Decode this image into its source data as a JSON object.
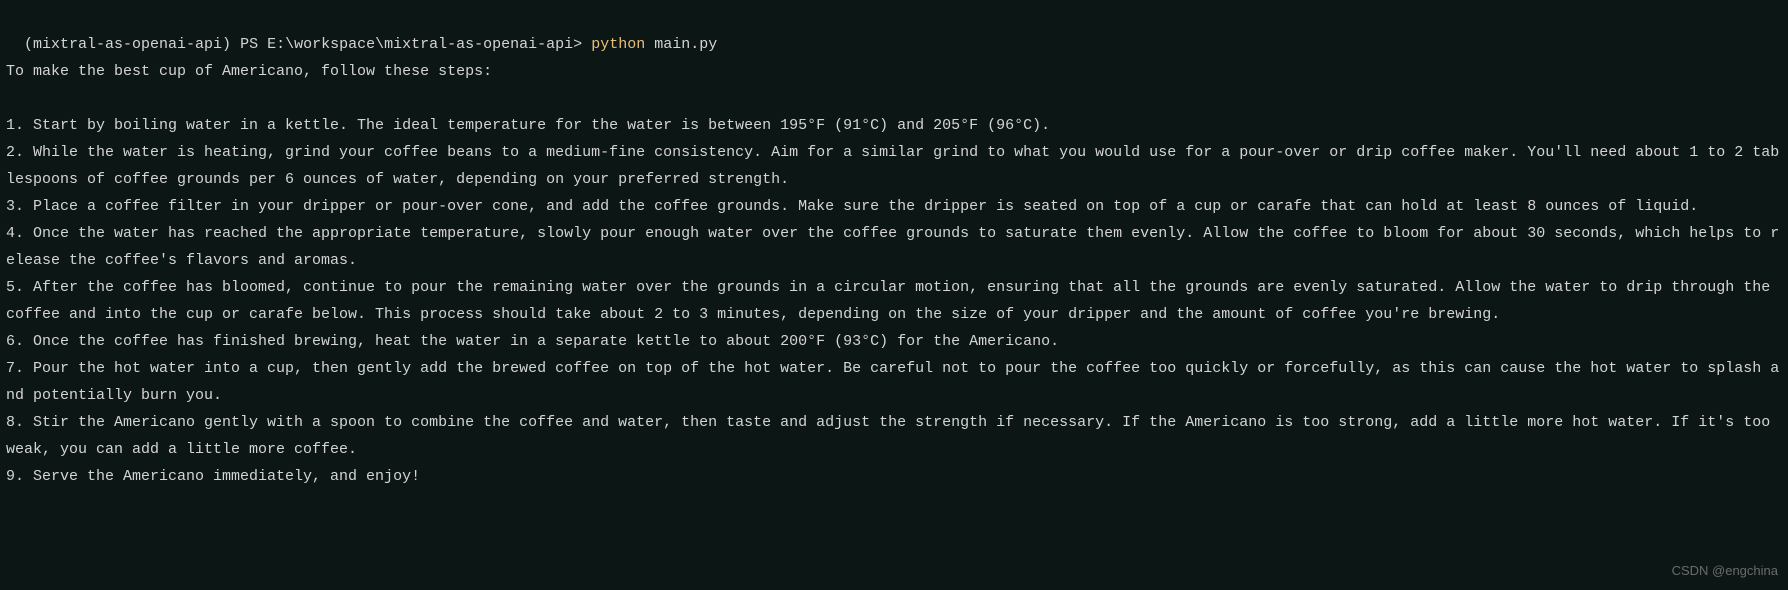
{
  "prompt": {
    "env": "(mixtral-as-openai-api)",
    "shell": "PS",
    "path": "E:\\workspace\\mixtral-as-openai-api>",
    "command": "python",
    "arg": "main.py"
  },
  "output": {
    "intro": "To make the best cup of Americano, follow these steps:",
    "steps": [
      "1. Start by boiling water in a kettle. The ideal temperature for the water is between 195°F (91°C) and 205°F (96°C).",
      "2. While the water is heating, grind your coffee beans to a medium-fine consistency. Aim for a similar grind to what you would use for a pour-over or drip coffee maker. You'll need about 1 to 2 tablespoons of coffee grounds per 6 ounces of water, depending on your preferred strength.",
      "3. Place a coffee filter in your dripper or pour-over cone, and add the coffee grounds. Make sure the dripper is seated on top of a cup or carafe that can hold at least 8 ounces of liquid.",
      "4. Once the water has reached the appropriate temperature, slowly pour enough water over the coffee grounds to saturate them evenly. Allow the coffee to bloom for about 30 seconds, which helps to release the coffee's flavors and aromas.",
      "5. After the coffee has bloomed, continue to pour the remaining water over the grounds in a circular motion, ensuring that all the grounds are evenly saturated. Allow the water to drip through the coffee and into the cup or carafe below. This process should take about 2 to 3 minutes, depending on the size of your dripper and the amount of coffee you're brewing.",
      "6. Once the coffee has finished brewing, heat the water in a separate kettle to about 200°F (93°C) for the Americano.",
      "7. Pour the hot water into a cup, then gently add the brewed coffee on top of the hot water. Be careful not to pour the coffee too quickly or forcefully, as this can cause the hot water to splash and potentially burn you.",
      "8. Stir the Americano gently with a spoon to combine the coffee and water, then taste and adjust the strength if necessary. If the Americano is too strong, add a little more hot water. If it's too weak, you can add a little more coffee.",
      "9. Serve the Americano immediately, and enjoy!"
    ]
  },
  "watermark": "CSDN @engchina"
}
